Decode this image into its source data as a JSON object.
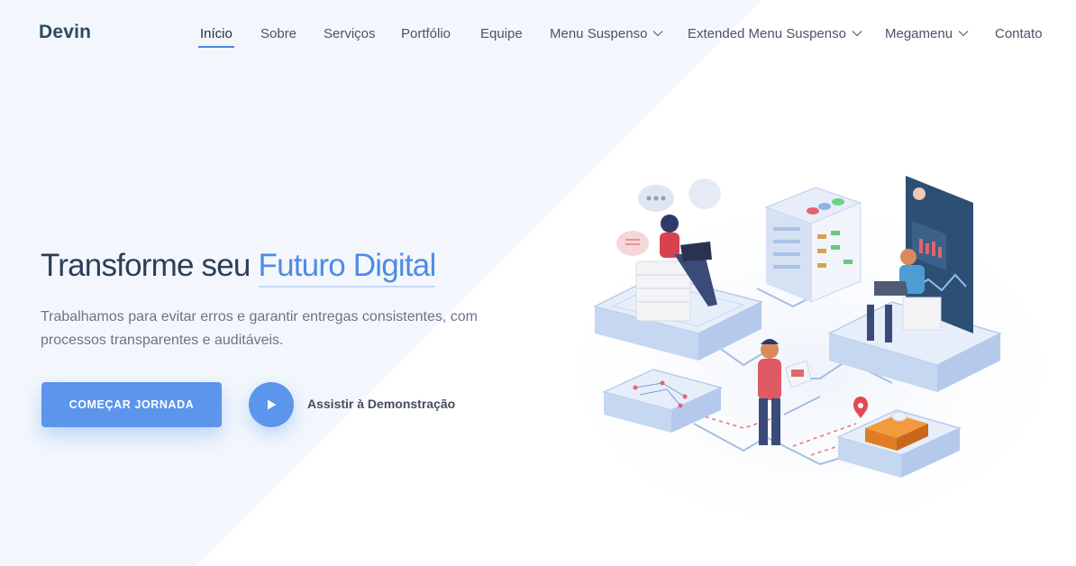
{
  "brand": {
    "name": "Devin"
  },
  "nav": {
    "items": [
      {
        "label": "Início",
        "active": true,
        "dropdown": false
      },
      {
        "label": "Sobre",
        "active": false,
        "dropdown": false
      },
      {
        "label": "Serviços",
        "active": false,
        "dropdown": false
      },
      {
        "label": "Portfólio",
        "active": false,
        "dropdown": false
      },
      {
        "label": "Equipe",
        "active": false,
        "dropdown": false
      },
      {
        "label": "Menu Suspenso",
        "active": false,
        "dropdown": true
      },
      {
        "label": "Extended Menu Suspenso",
        "active": false,
        "dropdown": true
      },
      {
        "label": "Megamenu",
        "active": false,
        "dropdown": true
      },
      {
        "label": "Contato",
        "active": false,
        "dropdown": false
      }
    ]
  },
  "hero": {
    "title_prefix": "Transforme seu ",
    "title_highlight": "Futuro Digital",
    "description": "Trabalhamos para evitar erros e garantir entregas consistentes, com processos transparentes e auditáveis.",
    "cta_label": "COMEÇAR JORNADA",
    "demo_label": "Assistir à Demonstração",
    "play_icon": "play-icon"
  },
  "colors": {
    "accent": "#5b95ec",
    "highlight_text": "#4f8be6",
    "heading": "#2c3e58",
    "body_text": "#6b7386",
    "background_tint": "#f3f7fd"
  },
  "illustration": {
    "name": "isometric-team-working-illustration"
  }
}
